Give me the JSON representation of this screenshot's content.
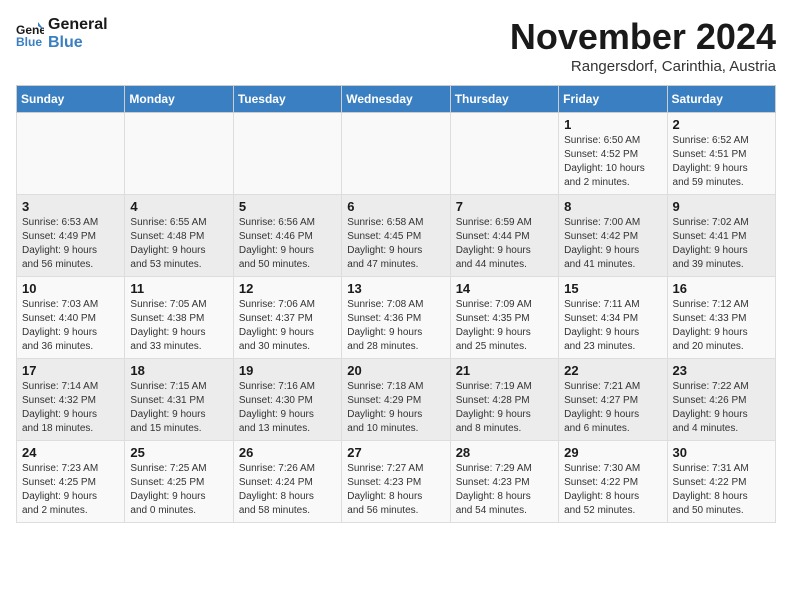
{
  "logo": {
    "line1": "General",
    "line2": "Blue"
  },
  "title": "November 2024",
  "location": "Rangersdorf, Carinthia, Austria",
  "days_of_week": [
    "Sunday",
    "Monday",
    "Tuesday",
    "Wednesday",
    "Thursday",
    "Friday",
    "Saturday"
  ],
  "weeks": [
    [
      {
        "day": "",
        "info": ""
      },
      {
        "day": "",
        "info": ""
      },
      {
        "day": "",
        "info": ""
      },
      {
        "day": "",
        "info": ""
      },
      {
        "day": "",
        "info": ""
      },
      {
        "day": "1",
        "info": "Sunrise: 6:50 AM\nSunset: 4:52 PM\nDaylight: 10 hours\nand 2 minutes."
      },
      {
        "day": "2",
        "info": "Sunrise: 6:52 AM\nSunset: 4:51 PM\nDaylight: 9 hours\nand 59 minutes."
      }
    ],
    [
      {
        "day": "3",
        "info": "Sunrise: 6:53 AM\nSunset: 4:49 PM\nDaylight: 9 hours\nand 56 minutes."
      },
      {
        "day": "4",
        "info": "Sunrise: 6:55 AM\nSunset: 4:48 PM\nDaylight: 9 hours\nand 53 minutes."
      },
      {
        "day": "5",
        "info": "Sunrise: 6:56 AM\nSunset: 4:46 PM\nDaylight: 9 hours\nand 50 minutes."
      },
      {
        "day": "6",
        "info": "Sunrise: 6:58 AM\nSunset: 4:45 PM\nDaylight: 9 hours\nand 47 minutes."
      },
      {
        "day": "7",
        "info": "Sunrise: 6:59 AM\nSunset: 4:44 PM\nDaylight: 9 hours\nand 44 minutes."
      },
      {
        "day": "8",
        "info": "Sunrise: 7:00 AM\nSunset: 4:42 PM\nDaylight: 9 hours\nand 41 minutes."
      },
      {
        "day": "9",
        "info": "Sunrise: 7:02 AM\nSunset: 4:41 PM\nDaylight: 9 hours\nand 39 minutes."
      }
    ],
    [
      {
        "day": "10",
        "info": "Sunrise: 7:03 AM\nSunset: 4:40 PM\nDaylight: 9 hours\nand 36 minutes."
      },
      {
        "day": "11",
        "info": "Sunrise: 7:05 AM\nSunset: 4:38 PM\nDaylight: 9 hours\nand 33 minutes."
      },
      {
        "day": "12",
        "info": "Sunrise: 7:06 AM\nSunset: 4:37 PM\nDaylight: 9 hours\nand 30 minutes."
      },
      {
        "day": "13",
        "info": "Sunrise: 7:08 AM\nSunset: 4:36 PM\nDaylight: 9 hours\nand 28 minutes."
      },
      {
        "day": "14",
        "info": "Sunrise: 7:09 AM\nSunset: 4:35 PM\nDaylight: 9 hours\nand 25 minutes."
      },
      {
        "day": "15",
        "info": "Sunrise: 7:11 AM\nSunset: 4:34 PM\nDaylight: 9 hours\nand 23 minutes."
      },
      {
        "day": "16",
        "info": "Sunrise: 7:12 AM\nSunset: 4:33 PM\nDaylight: 9 hours\nand 20 minutes."
      }
    ],
    [
      {
        "day": "17",
        "info": "Sunrise: 7:14 AM\nSunset: 4:32 PM\nDaylight: 9 hours\nand 18 minutes."
      },
      {
        "day": "18",
        "info": "Sunrise: 7:15 AM\nSunset: 4:31 PM\nDaylight: 9 hours\nand 15 minutes."
      },
      {
        "day": "19",
        "info": "Sunrise: 7:16 AM\nSunset: 4:30 PM\nDaylight: 9 hours\nand 13 minutes."
      },
      {
        "day": "20",
        "info": "Sunrise: 7:18 AM\nSunset: 4:29 PM\nDaylight: 9 hours\nand 10 minutes."
      },
      {
        "day": "21",
        "info": "Sunrise: 7:19 AM\nSunset: 4:28 PM\nDaylight: 9 hours\nand 8 minutes."
      },
      {
        "day": "22",
        "info": "Sunrise: 7:21 AM\nSunset: 4:27 PM\nDaylight: 9 hours\nand 6 minutes."
      },
      {
        "day": "23",
        "info": "Sunrise: 7:22 AM\nSunset: 4:26 PM\nDaylight: 9 hours\nand 4 minutes."
      }
    ],
    [
      {
        "day": "24",
        "info": "Sunrise: 7:23 AM\nSunset: 4:25 PM\nDaylight: 9 hours\nand 2 minutes."
      },
      {
        "day": "25",
        "info": "Sunrise: 7:25 AM\nSunset: 4:25 PM\nDaylight: 9 hours\nand 0 minutes."
      },
      {
        "day": "26",
        "info": "Sunrise: 7:26 AM\nSunset: 4:24 PM\nDaylight: 8 hours\nand 58 minutes."
      },
      {
        "day": "27",
        "info": "Sunrise: 7:27 AM\nSunset: 4:23 PM\nDaylight: 8 hours\nand 56 minutes."
      },
      {
        "day": "28",
        "info": "Sunrise: 7:29 AM\nSunset: 4:23 PM\nDaylight: 8 hours\nand 54 minutes."
      },
      {
        "day": "29",
        "info": "Sunrise: 7:30 AM\nSunset: 4:22 PM\nDaylight: 8 hours\nand 52 minutes."
      },
      {
        "day": "30",
        "info": "Sunrise: 7:31 AM\nSunset: 4:22 PM\nDaylight: 8 hours\nand 50 minutes."
      }
    ]
  ]
}
